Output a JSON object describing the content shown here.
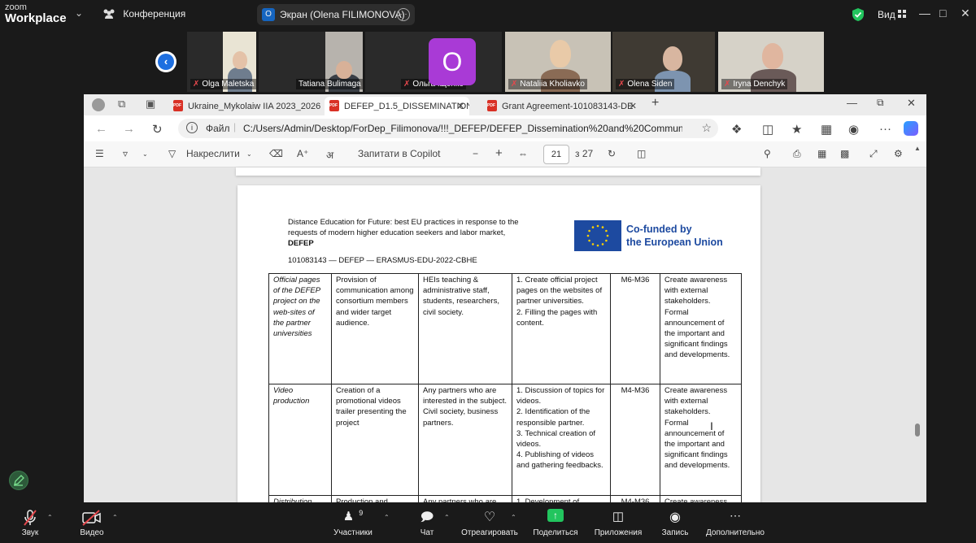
{
  "zoom": {
    "logo_line1": "zoom",
    "logo_line2": "Workplace",
    "conference_label": "Конференция",
    "share_initial": "O",
    "share_label": "Экран (Olena FILIMONOVA)",
    "view_label": "Вид"
  },
  "participants": [
    {
      "name": "Olga Maletska"
    },
    {
      "name": "Tatiana Bulimaga"
    },
    {
      "name": "Ольга Іщенко",
      "initial": "O"
    },
    {
      "name": "Nataliia Kholiavko"
    },
    {
      "name": "Olena Siden"
    },
    {
      "name": "Iryna Denchyk"
    }
  ],
  "browser": {
    "tabs": [
      {
        "label": "Ukraine_Mykolaiw IIA 2023_2026"
      },
      {
        "label": "DEFEP_D1.5_DISSEMINATION AN"
      },
      {
        "label": "Grant Agreement-101083143-DE"
      }
    ],
    "url_file_label": "Файл",
    "url_path": "C:/Users/Admin/Desktop/ForDep_Filimonova/!!!_DEFEP/DEFEP_Dissemination%20and%20Communication..."
  },
  "pdf_toolbar": {
    "draw_label": "Накреслити",
    "copilot_label": "Запитати в Copilot",
    "page_current": "21",
    "page_total": "з 27"
  },
  "document": {
    "header_text": "Distance Education for Future: best EU practices in response to the requests of modern higher education seekers and labor market, ",
    "header_bold": "DEFEP",
    "project_code": "101083143 — DEFEP — ERASMUS-EDU-2022-CBHE",
    "eu_line1": "Co-funded by",
    "eu_line2": "the European Union",
    "rows": [
      {
        "channel": "Official pages of the DEFEP project on the web-sites of the partner universities",
        "purpose": "Provision of communication among consortium members and wider target audience.",
        "audience": "HEIs teaching & administrative staff, students, researchers, civil society.",
        "activities": "1. Create official project pages on the websites of partner universities.\n2. Filling the pages with content.",
        "timing": "M6-M36",
        "impact": "Create awareness with external stakeholders.\nFormal announcement of the important and significant findings and developments."
      },
      {
        "channel": "Video production",
        "purpose": "Creation of a promotional videos trailer presenting the project",
        "audience": "Any partners who are interested in the subject. Civil society, business partners.",
        "activities": "1. Discussion of topics for videos.\n2. Identification of the responsible partner.\n3. Technical creation of videos.\n4. Publishing of videos and gathering feedbacks.",
        "timing": "M4-M36",
        "impact": "Create awareness with external stakeholders.\nFormal announcement of the important and significant findings and developments."
      },
      {
        "channel": "Distribution",
        "purpose": "Production and",
        "audience": "Any partners who are",
        "activities": "1. Development of",
        "timing": "M4-M36",
        "impact": "Create awareness"
      }
    ]
  },
  "bottom_toolbar": {
    "audio": "Звук",
    "video": "Видео",
    "participants": "Участники",
    "participants_count": "9",
    "chat": "Чат",
    "react": "Отреагировать",
    "share": "Поделиться",
    "apps": "Приложения",
    "record": "Запись",
    "more": "Дополнительно"
  },
  "colors": {
    "share_green": "#22c55e",
    "mic_off_red": "#e5484d",
    "eu_blue": "#1d4aa0"
  }
}
